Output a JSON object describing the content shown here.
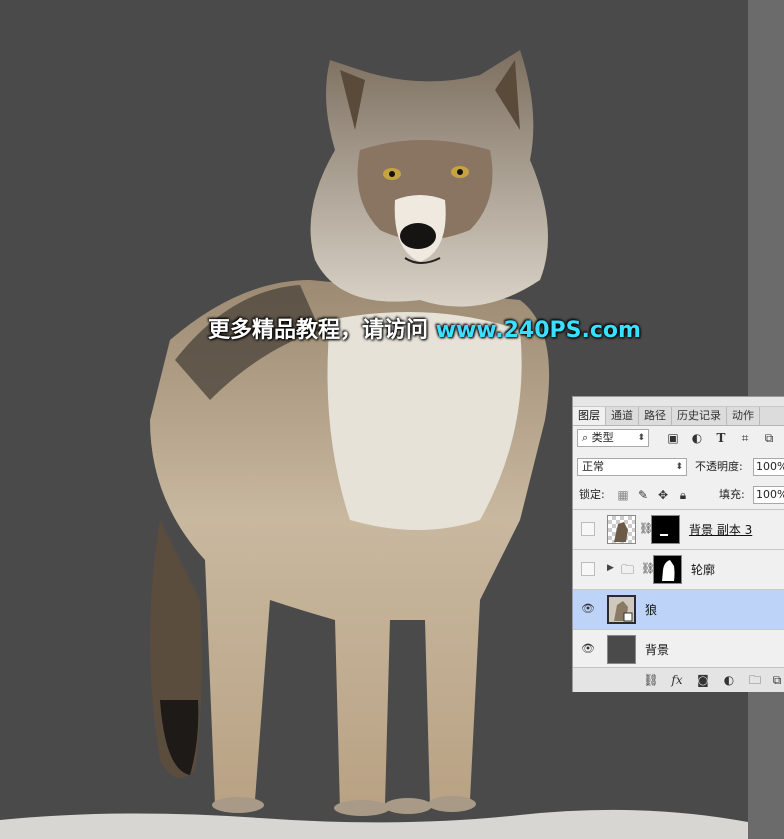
{
  "watermark": {
    "text_cn": "更多精品教程，请访问 ",
    "text_url": "www.240PS.com"
  },
  "panel": {
    "tabs": [
      {
        "label": "图层",
        "active": true
      },
      {
        "label": "通道",
        "active": false
      },
      {
        "label": "路径",
        "active": false
      },
      {
        "label": "历史记录",
        "active": false
      },
      {
        "label": "动作",
        "active": false
      }
    ],
    "filter": {
      "label": "类型",
      "icon": "search-icon"
    },
    "blend_mode": "正常",
    "opacity_label": "不透明度:",
    "opacity_value": "100%",
    "lock_label": "锁定:",
    "fill_label": "填充:",
    "fill_value": "100%",
    "layers": [
      {
        "name": "背景 副本 3",
        "visible": false,
        "has_mask": true,
        "selected": false
      },
      {
        "name": "轮廓",
        "visible": false,
        "is_group": true,
        "has_mask": true,
        "selected": false
      },
      {
        "name": "狼",
        "visible": true,
        "selected": true
      },
      {
        "name": "背景",
        "visible": true,
        "selected": false
      }
    ]
  },
  "colors": {
    "canvas_bg": "#4a4a4a",
    "watermark_url": "#39e0ff",
    "selected_layer": "#bdd4f8"
  }
}
